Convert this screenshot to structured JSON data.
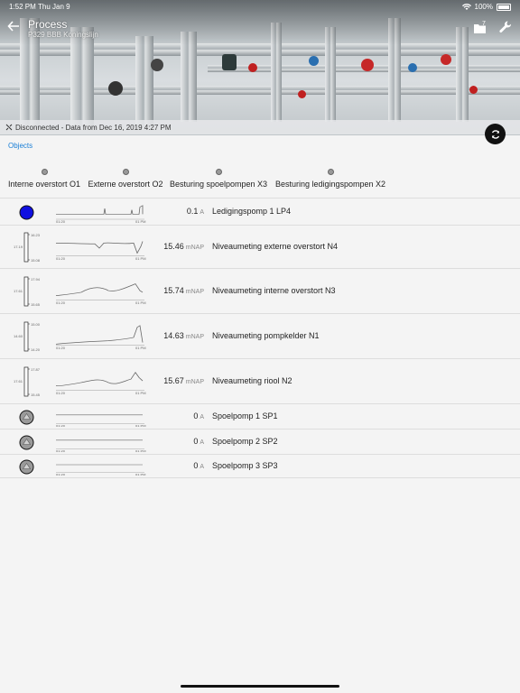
{
  "status_bar": {
    "time": "1:52 PM",
    "date": "Thu Jan 9",
    "battery": "100%"
  },
  "header": {
    "title": "Process",
    "subtitle": "P329 BBB Koningslijn",
    "badge_count": "7"
  },
  "connection": {
    "status_text": "Disconnected - Data from Dec 16, 2019 4:27 PM"
  },
  "objects_link": "Objects",
  "columns": [
    {
      "label": "Interne overstort O1"
    },
    {
      "label": "Externe overstort O2"
    },
    {
      "label": "Besturing spoelpompen X3"
    },
    {
      "label": "Besturing ledigingspompen X2"
    }
  ],
  "rows": [
    {
      "kind": "pump-on",
      "value": "0.1",
      "unit": "A",
      "name": "Ledigingspomp 1 LP4",
      "spark_start": "01:20",
      "spark_end": "01 PM"
    },
    {
      "kind": "level",
      "value": "15.46",
      "unit": "mNAP",
      "name": "Niveaumeting externe overstort N4",
      "spark_start": "01:20",
      "spark_end": "01 PM",
      "gauge_top": "16.23",
      "gauge_bottom": "15.08",
      "gauge_current": "17.19",
      "gauge_color": "#3a9a3a"
    },
    {
      "kind": "level",
      "value": "15.74",
      "unit": "mNAP",
      "name": "Niveaumeting interne overstort N3",
      "spark_start": "01:20",
      "spark_end": "01 PM",
      "gauge_top": "17.94",
      "gauge_bottom": "15.65",
      "gauge_current": "17.61",
      "gauge_color": "#3a9a3a"
    },
    {
      "kind": "level",
      "value": "14.63",
      "unit": "mNAP",
      "name": "Niveaumeting pompkelder N1",
      "spark_start": "01:20",
      "spark_end": "01 PM",
      "gauge_top": "15.00",
      "gauge_bottom": "14.20",
      "gauge_current": "14.60",
      "gauge_color": "#2f3fb0"
    },
    {
      "kind": "level",
      "value": "15.67",
      "unit": "mNAP",
      "name": "Niveaumeting riool N2",
      "spark_start": "01:20",
      "spark_end": "01 PM",
      "gauge_top": "17.87",
      "gauge_bottom": "15.45",
      "gauge_current": "17.61",
      "gauge_color": "#3a9a3a"
    },
    {
      "kind": "pump-off",
      "value": "0",
      "unit": "A",
      "name": "Spoelpomp 1 SP1",
      "spark_start": "01:20",
      "spark_end": "01 PM"
    },
    {
      "kind": "pump-off",
      "value": "0",
      "unit": "A",
      "name": "Spoelpomp 2 SP2",
      "spark_start": "01:20",
      "spark_end": "01 PM"
    },
    {
      "kind": "pump-off",
      "value": "0",
      "unit": "A",
      "name": "Spoelpomp 3 SP3",
      "spark_start": "01:20",
      "spark_end": "01 PM"
    }
  ],
  "colors": {
    "accent": "#1a7fd6",
    "pump_on": "#1010e0",
    "pump_off": "#9a9a9a"
  }
}
